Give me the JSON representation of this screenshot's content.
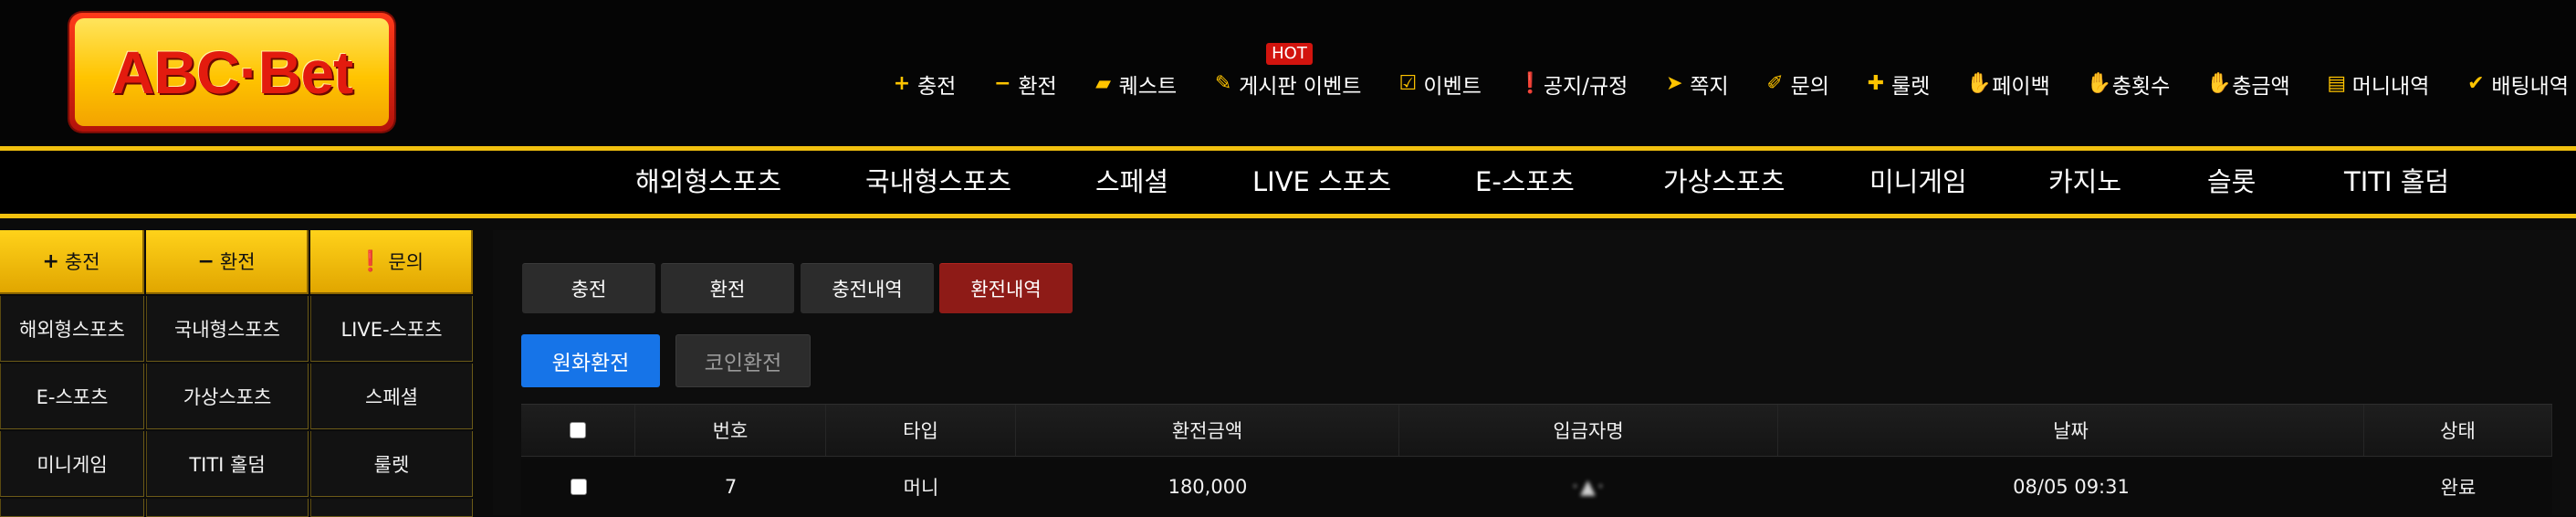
{
  "logo": {
    "text": "ABC·Bet"
  },
  "top_menu": [
    {
      "icon": "plus-icon",
      "glyph": "+",
      "label": "충전"
    },
    {
      "icon": "minus-icon",
      "glyph": "−",
      "label": "환전"
    },
    {
      "icon": "quest-icon",
      "glyph": "▰",
      "label": "퀘스트"
    },
    {
      "icon": "board-icon",
      "glyph": "✎",
      "label": "게시판 이벤트",
      "badge": "HOT"
    },
    {
      "icon": "calendar-check-icon",
      "glyph": "☑",
      "label": "이벤트"
    },
    {
      "icon": "info-icon",
      "glyph": "❗",
      "label": "공지/규정"
    },
    {
      "icon": "paper-plane-icon",
      "glyph": "➤",
      "label": "쪽지"
    },
    {
      "icon": "edit-icon",
      "glyph": "✐",
      "label": "문의"
    },
    {
      "icon": "gift-icon",
      "glyph": "✚",
      "label": "룰렛"
    },
    {
      "icon": "hand-coin-icon",
      "glyph": "✋",
      "label": "페이백"
    },
    {
      "icon": "hand-coin-icon",
      "glyph": "✋",
      "label": "충횟수"
    },
    {
      "icon": "hand-coin-icon",
      "glyph": "✋",
      "label": "충금액"
    },
    {
      "icon": "clipboard-icon",
      "glyph": "▤",
      "label": "머니내역"
    },
    {
      "icon": "check-icon",
      "glyph": "✔",
      "label": "배팅내역"
    }
  ],
  "main_nav": [
    "해외형스포츠",
    "국내형스포츠",
    "스페셜",
    "LIVE 스포츠",
    "E-스포츠",
    "가상스포츠",
    "미니게임",
    "카지노",
    "슬롯",
    "TITI 홀덤"
  ],
  "sidebar": {
    "top_buttons": [
      {
        "icon": "plus-icon",
        "glyph": "+",
        "label": "충전"
      },
      {
        "icon": "minus-icon",
        "glyph": "−",
        "label": "환전"
      },
      {
        "icon": "info-icon",
        "glyph": "❗",
        "label": "문의"
      }
    ],
    "grid": [
      "해외형스포츠",
      "국내형스포츠",
      "LIVE-스포츠",
      "E-스포츠",
      "가상스포츠",
      "스페셜",
      "미니게임",
      "TITI 홀덤",
      "룰렛"
    ]
  },
  "tabs": [
    {
      "label": "충전",
      "active": false
    },
    {
      "label": "환전",
      "active": false
    },
    {
      "label": "충전내역",
      "active": false
    },
    {
      "label": "환전내역",
      "active": true
    }
  ],
  "sub_tabs": [
    {
      "label": "원화환전",
      "active": true
    },
    {
      "label": "코인환전",
      "active": false
    }
  ],
  "table": {
    "headers": [
      "",
      "번호",
      "타입",
      "환전금액",
      "입금자명",
      "날짜",
      "상태"
    ],
    "rows": [
      {
        "no": "7",
        "type": "머니",
        "amount": "180,000",
        "name": "·▲·",
        "date": "08/05 09:31",
        "status": "완료"
      }
    ]
  },
  "colors": {
    "gold": "#f2c10f",
    "active_tab": "#8e1b17",
    "primary": "#1674e8",
    "hot": "#d2140e"
  }
}
